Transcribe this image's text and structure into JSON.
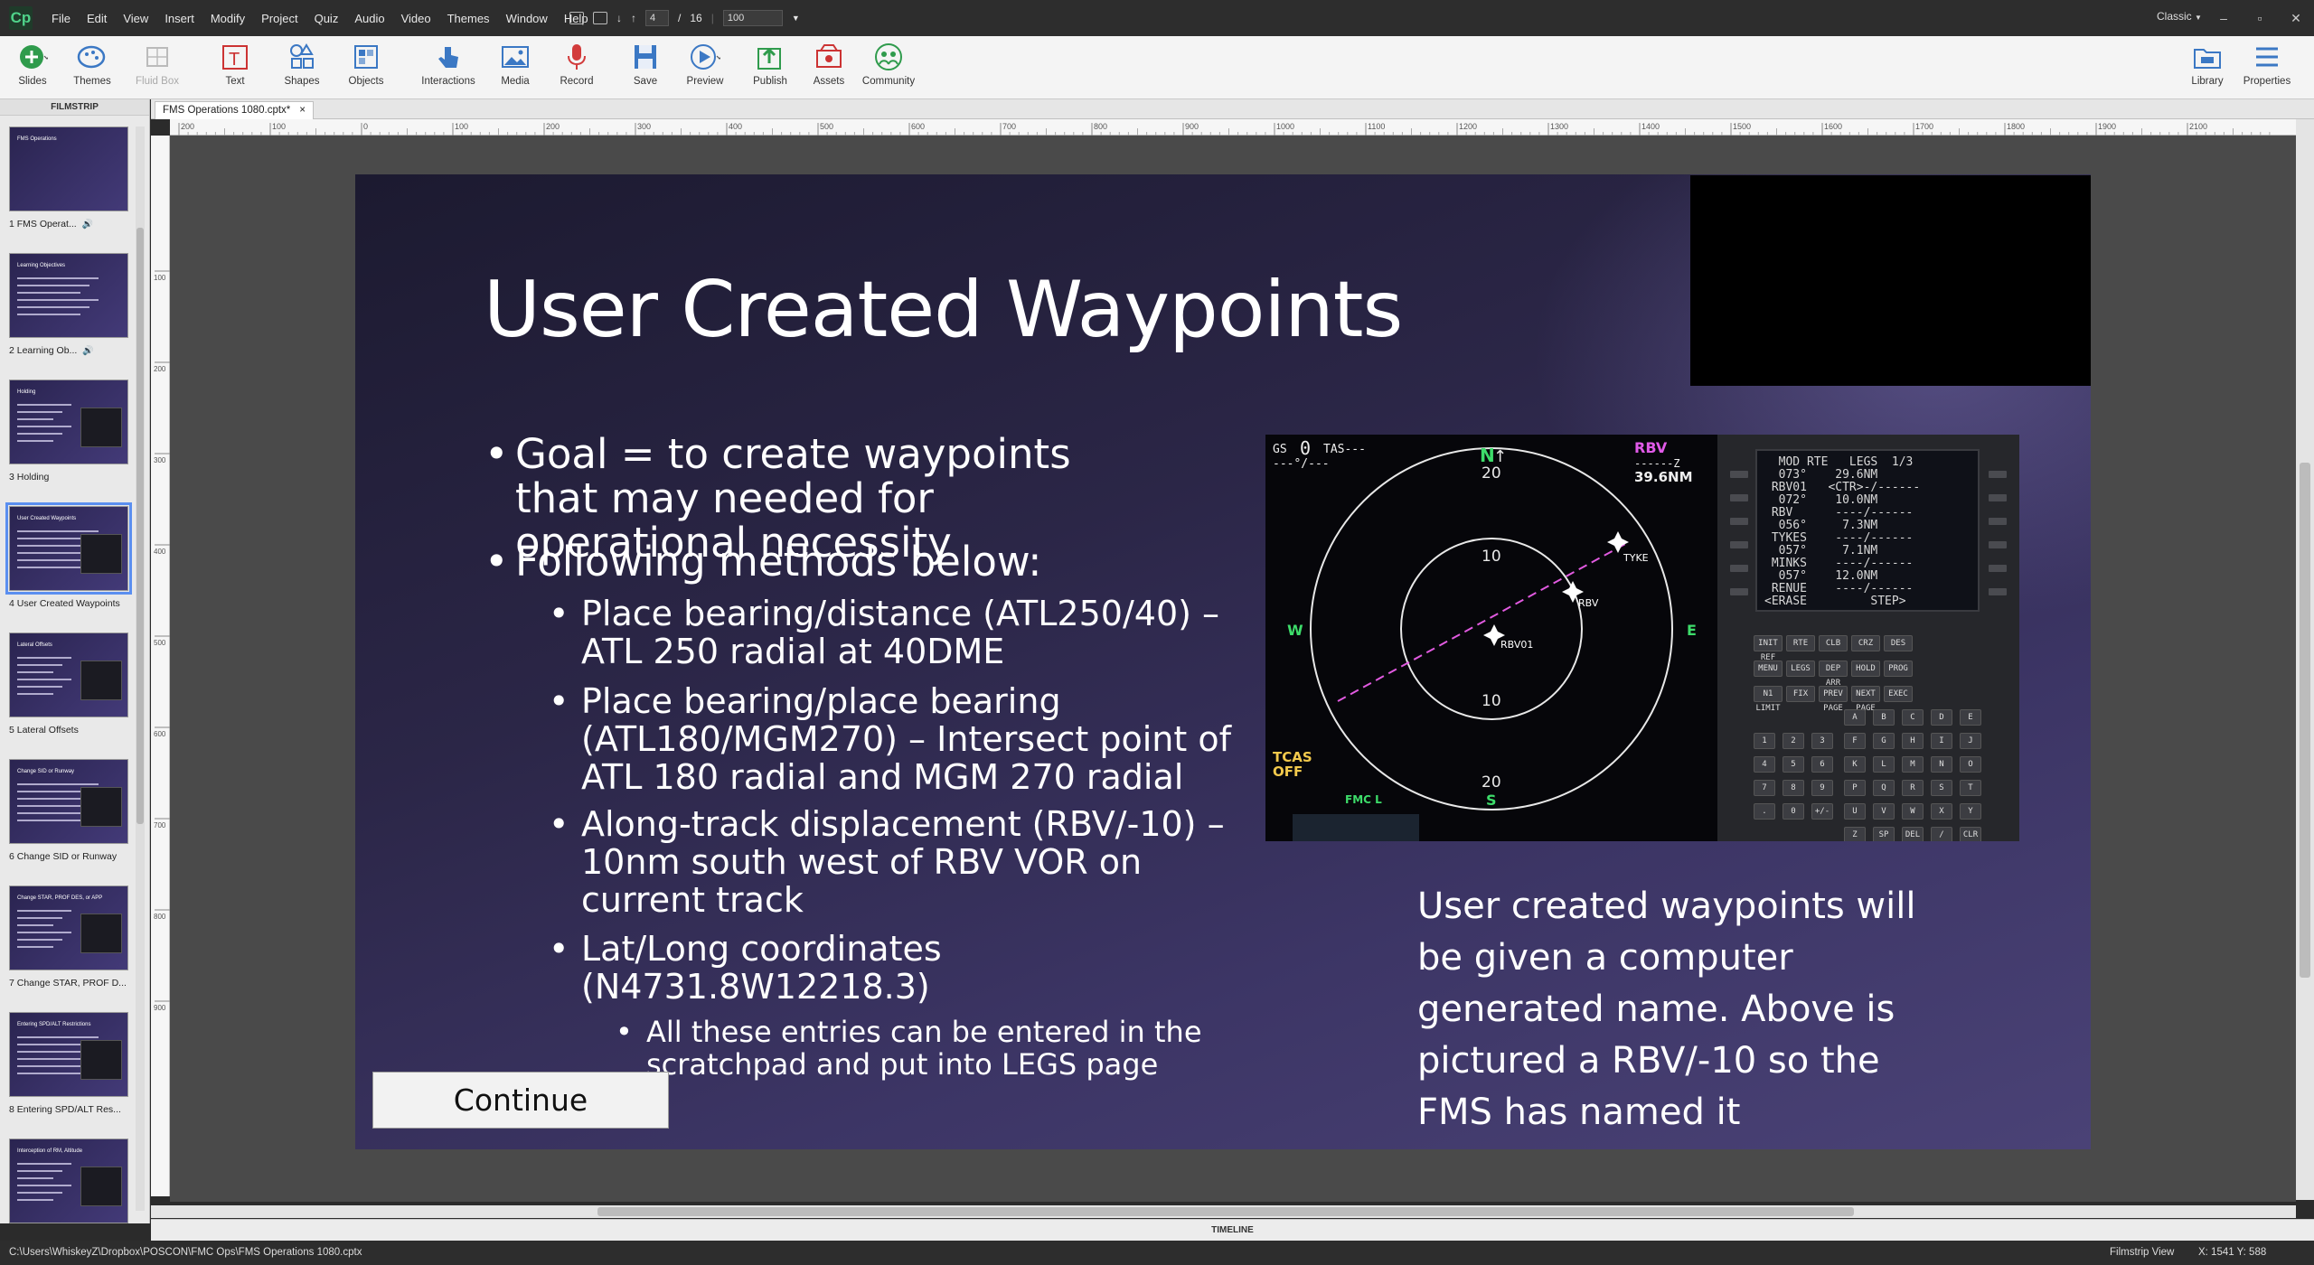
{
  "app": {
    "logo": "Cp",
    "menus": [
      "File",
      "Edit",
      "View",
      "Insert",
      "Modify",
      "Project",
      "Quiz",
      "Audio",
      "Video",
      "Themes",
      "Window",
      "Help"
    ],
    "slide_current": "4",
    "slide_total": "16",
    "zoom": "100",
    "mode": "Classic"
  },
  "toolbar": {
    "slides": "Slides",
    "themes": "Themes",
    "fluid_box": "Fluid Box",
    "text": "Text",
    "shapes": "Shapes",
    "objects": "Objects",
    "interactions": "Interactions",
    "media": "Media",
    "record": "Record",
    "save": "Save",
    "preview": "Preview",
    "publish": "Publish",
    "assets": "Assets",
    "community": "Community",
    "library": "Library",
    "properties": "Properties"
  },
  "filmstrip": {
    "header": "FILMSTRIP",
    "items": [
      {
        "label": "1 FMS Operat...",
        "thumb_title": "FMS Operations"
      },
      {
        "label": "2 Learning Ob...",
        "thumb_title": "Learning Objectives"
      },
      {
        "label": "3 Holding",
        "thumb_title": "Holding"
      },
      {
        "label": "4 User Created Waypoints",
        "thumb_title": "User Created Waypoints"
      },
      {
        "label": "5 Lateral Offsets",
        "thumb_title": "Lateral Offsets"
      },
      {
        "label": "6 Change SID or Runway",
        "thumb_title": "Change SID or Runway"
      },
      {
        "label": "7 Change STAR, PROF D...",
        "thumb_title": "Change STAR, PROF DES, or APP"
      },
      {
        "label": "8 Entering SPD/ALT Res...",
        "thumb_title": "Entering SPD/ALT Restrictions"
      },
      {
        "label": "",
        "thumb_title": "Interception of RM, Altitude"
      }
    ]
  },
  "document": {
    "tab_title": "FMS Operations 1080.cptx*",
    "tab_close": "×"
  },
  "ruler": {
    "h_ticks": [
      "200",
      "100",
      "0",
      "100",
      "200",
      "300",
      "400",
      "500",
      "600",
      "700",
      "800",
      "900",
      "1000",
      "1100",
      "1200",
      "1300",
      "1400",
      "1500",
      "1600",
      "1700",
      "1800",
      "1900",
      "2100"
    ],
    "v_ticks": [
      "100",
      "200",
      "300",
      "400",
      "500",
      "600",
      "700",
      "800",
      "900"
    ]
  },
  "slide": {
    "title": "User Created Waypoints",
    "bullets": {
      "b1": "Goal = to create waypoints that may needed for operational necessity",
      "b2": "Following methods below:",
      "s1": "Place bearing/distance (ATL250/40) – ATL 250 radial at 40DME",
      "s2": "Place bearing/place bearing (ATL180/MGM270) – Intersect point of ATL 180 radial and MGM 270 radial",
      "s3": "Along-track displacement (RBV/-10) – 10nm south west of RBV VOR on current track",
      "s4": "Lat/Long coordinates (N4731.8W12218.3)",
      "ss1": "All these entries can be entered in the scratchpad and put into LEGS page"
    },
    "caption": "User created waypoints will be given a computer generated name. Above is pictured a RBV/-10 so the FMS has named it",
    "continue_label": "Continue",
    "nd": {
      "gs": "GS",
      "gs_val": "0",
      "tas": "TAS---",
      "wind": "---°/---",
      "north": "N",
      "ring_20_top": "20",
      "ring_10_top": "10",
      "ring_10_bot": "10",
      "ring_20_bot": "20",
      "west": "W",
      "east": "E",
      "south": "S",
      "wpt_active": "RBV",
      "wpt_time": "------Z",
      "wpt_dist": "39.6NM",
      "fix1": "TYKE",
      "fix2": "RBV",
      "fix3": "RBV01",
      "tcas": "TCAS",
      "tcas_state": "OFF",
      "fmc": "FMC L"
    },
    "cdu": {
      "screen": "  MOD RTE   LEGS  1/3\n  073°    29.6NM\n RBV01   <CTR>-/------\n  072°    10.0NM\n RBV      ----/------\n  056°     7.3NM\n TYKES    ----/------\n  057°     7.1NM\n MINKS    ----/------\n  057°    12.0NM\n RENUE    ----/------\n<ERASE         STEP>",
      "func_keys": [
        "INIT REF",
        "RTE",
        "CLB",
        "CRZ",
        "DES",
        "MENU",
        "LEGS",
        "DEP ARR",
        "HOLD",
        "PROG",
        "N1 LIMIT",
        "FIX",
        "PREV PAGE",
        "NEXT PAGE",
        "EXEC"
      ],
      "alpha_keys": [
        "A",
        "B",
        "C",
        "D",
        "E",
        "F",
        "G",
        "H",
        "I",
        "J",
        "K",
        "L",
        "M",
        "N",
        "O",
        "P",
        "Q",
        "R",
        "S",
        "T",
        "U",
        "V",
        "W",
        "X",
        "Y",
        "Z",
        "SP",
        "DEL",
        "/",
        "CLR"
      ],
      "num_keys": [
        "1",
        "2",
        "3",
        "4",
        "5",
        "6",
        "7",
        "8",
        "9",
        ".",
        "0",
        "+/-"
      ]
    }
  },
  "timeline_label": "TIMELINE",
  "status": {
    "path": "C:\\Users\\WhiskeyZ\\Dropbox\\POSCON\\FMC Ops\\FMS Operations 1080.cptx",
    "view": "Filmstrip View",
    "coords": "X: 1541 Y: 588"
  },
  "colors": {
    "accent": "#5b8ff0",
    "nd_green": "#3ddc6a",
    "nd_magenta": "#e05ae8",
    "tcas_amber": "#f2c94c"
  }
}
